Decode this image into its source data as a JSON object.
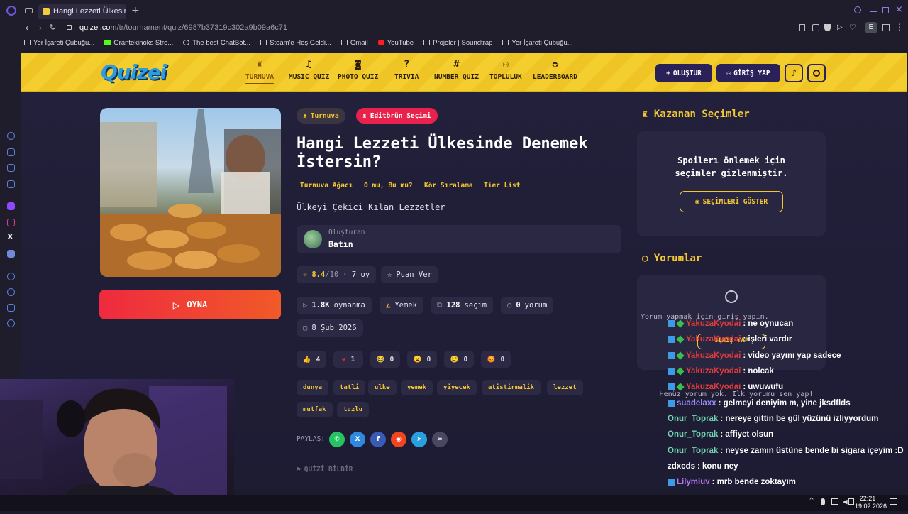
{
  "browser": {
    "tab_title": "Hangi Lezzeti Ülkesinde De",
    "url_domain": "quizei.com",
    "url_path": "/tr/tournament/quiz/6987b37319c302a9b09a6c71",
    "bookmarks": [
      "Yer İşareti Çubuğu...",
      "Grantekinoks Stre...",
      "The best ChatBot...",
      "Steam'e Hoş Geldi...",
      "Gmail",
      "YouTube",
      "Projeler | Soundtrap",
      "Yer İşareti Çubuğu..."
    ],
    "profile_initial": "E"
  },
  "header": {
    "logo": "Quizei",
    "nav": [
      {
        "label": "TURNUVA",
        "icon": "trophy-icon"
      },
      {
        "label": "MUSIC QUIZ",
        "icon": "music-icon"
      },
      {
        "label": "PHOTO QUIZ",
        "icon": "camera-icon"
      },
      {
        "label": "TRIVIA",
        "icon": "question-icon"
      },
      {
        "label": "NUMBER QUIZ",
        "icon": "hash-icon"
      },
      {
        "label": "TOPLULUK",
        "icon": "users-icon"
      },
      {
        "label": "LEADERBOARD",
        "icon": "medal-icon"
      }
    ],
    "create_label": "OLUŞTUR",
    "login_label": "GİRİŞ YAP"
  },
  "quiz": {
    "badge_type": "Turnuva",
    "badge_editor": "Editörün Seçimi",
    "title_line1": "Hangi Lezzeti Ülkesinde Denemek",
    "title_line2": "İstersin?",
    "modes": [
      "Turnuva Ağacı",
      "O mu, Bu mu?",
      "Kör Sıralama",
      "Tier List"
    ],
    "subtitle": "Ülkeyi Çekici Kılan Lezzetler",
    "creator_caption": "Oluşturan",
    "creator_name": "Batın",
    "rating": "8.4",
    "rating_max": "/10",
    "votes": "· 7 oy",
    "rate_label": "Puan Ver",
    "plays_value": "1.8K",
    "plays_label": "oynanma",
    "category": "Yemek",
    "choices_value": "128",
    "choices_label": "seçim",
    "comments_value": "0",
    "comments_label": "yorum",
    "date": "8 Şub 2026",
    "play_label": "OYNA",
    "reactions": [
      {
        "emoji": "👍",
        "count": "4"
      },
      {
        "emoji": "❤",
        "count": "1"
      },
      {
        "emoji": "😂",
        "count": "0"
      },
      {
        "emoji": "😮",
        "count": "0"
      },
      {
        "emoji": "😢",
        "count": "0"
      },
      {
        "emoji": "😡",
        "count": "0"
      }
    ],
    "keywords": [
      "dunya",
      "tatli",
      "ulke",
      "yemek",
      "yiyecek",
      "atistirmalik",
      "lezzet",
      "mutfak",
      "tuzlu"
    ],
    "share_label": "PAYLAŞ:",
    "report_label": "QUİZİ BİLDİR"
  },
  "sidebar": {
    "winners_title": "Kazanan Seçimler",
    "spoiler_text_1": "Spoilerı önlemek için",
    "spoiler_text_2": "seçimler gizlenmiştir.",
    "show_button": "SEÇİMLERİ GÖSTER",
    "comments_title": "Yorumlar",
    "login_prompt": "Yorum yapmak için giriş yapın.",
    "login_button": "GİRİŞ YAP",
    "no_comments": "Henüz yorum yok. İlk yorumu sen yap!"
  },
  "chat": [
    {
      "user": "YakuzaKyodai",
      "msg": ": ne oynucan",
      "color": "#e03c3c",
      "badges": 2
    },
    {
      "user": "YakuzaKyodai",
      "msg": ": işleri vardır",
      "color": "#e03c3c",
      "badges": 2
    },
    {
      "user": "YakuzaKyodai",
      "msg": ": video yayını yap sadece",
      "color": "#e03c3c",
      "badges": 2
    },
    {
      "user": "YakuzaKyodai",
      "msg": ": nolcak",
      "color": "#e03c3c",
      "badges": 2
    },
    {
      "user": "YakuzaKyodai",
      "msg": ": uwuwufu",
      "color": "#e03c3c",
      "badges": 2
    },
    {
      "user": "suadelaxx",
      "msg": ": gelmeyi deniyim m, yine jksdflds",
      "color": "#9b8cff",
      "badges": 1
    },
    {
      "user": "Onur_Toprak",
      "msg": ": nereye gittin be gül yüzünü izliyyordum",
      "color": "#6fd4b0",
      "badges": 0
    },
    {
      "user": "Onur_Toprak",
      "msg": ": affiyet olsun",
      "color": "#6fd4b0",
      "badges": 0
    },
    {
      "user": "Onur_Toprak",
      "msg": ": neyse zamın üstüne bende bi sigara içeyim :D",
      "color": "#6fd4b0",
      "badges": 0
    },
    {
      "user": "zdxcds",
      "msg": ": konu ney",
      "color": "#ffffff",
      "badges": 0
    },
    {
      "user": "Lilymiuv",
      "msg": ": mrb bende zoktayım",
      "color": "#b877f0",
      "badges": 1
    }
  ],
  "stream": {
    "kick_count": "5"
  },
  "taskbar": {
    "time": "22:21",
    "date": "19.02.2026"
  }
}
